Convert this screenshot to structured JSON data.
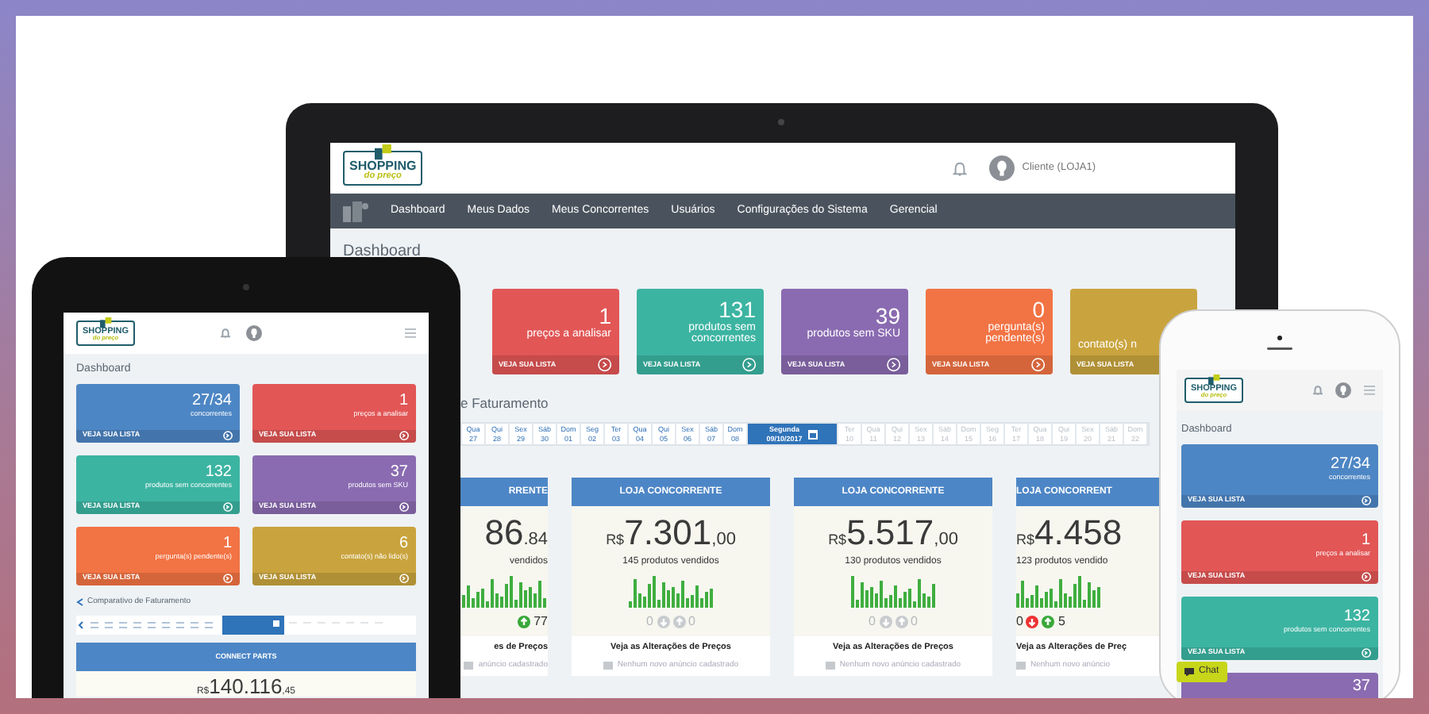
{
  "laptop": {
    "logo": {
      "name": "SHOPPING",
      "tagline": "do preço"
    },
    "user": "Cliente (LOJA1)",
    "nav": [
      "Dashboard",
      "Meus Dados",
      "Meus Concorrentes",
      "Usuários",
      "Configurações do Sistema",
      "Gerencial"
    ],
    "title": "Dashboard",
    "cards": [
      {
        "kind": "full",
        "value": "1",
        "label": "preços a analisar",
        "link": "VEJA SUA LISTA",
        "color": "#e25656"
      },
      {
        "kind": "full",
        "value": "131",
        "label": "produtos sem concorrentes",
        "link": "VEJA SUA LISTA",
        "color": "#3cb4a2"
      },
      {
        "kind": "full",
        "value": "39",
        "label": "produtos sem SKU",
        "link": "VEJA SUA LISTA",
        "color": "#8a6bb1"
      },
      {
        "kind": "full",
        "value": "0",
        "label": "pergunta(s) pendente(s)",
        "link": "VEJA SUA LISTA",
        "color": "#f27344"
      },
      {
        "kind": "cut",
        "label": "contato(s) n",
        "link": "VEJA SUA LISTA",
        "color": "#c9a43e"
      }
    ],
    "chart_title": "e Faturamento",
    "dates": [
      {
        "day": "Qua",
        "date": "27",
        "selected": false,
        "disabled": false
      },
      {
        "day": "Qui",
        "date": "28",
        "selected": false,
        "disabled": false
      },
      {
        "day": "Sex",
        "date": "29",
        "selected": false,
        "disabled": false
      },
      {
        "day": "Sáb",
        "date": "30",
        "selected": false,
        "disabled": false
      },
      {
        "day": "Dom",
        "date": "01",
        "selected": false,
        "disabled": false
      },
      {
        "day": "Seg",
        "date": "02",
        "selected": false,
        "disabled": false
      },
      {
        "day": "Ter",
        "date": "03",
        "selected": false,
        "disabled": false
      },
      {
        "day": "Qua",
        "date": "04",
        "selected": false,
        "disabled": false
      },
      {
        "day": "Qui",
        "date": "05",
        "selected": false,
        "disabled": false
      },
      {
        "day": "Sex",
        "date": "06",
        "selected": false,
        "disabled": false
      },
      {
        "day": "Sáb",
        "date": "07",
        "selected": false,
        "disabled": false
      },
      {
        "day": "Dom",
        "date": "08",
        "selected": false,
        "disabled": false
      },
      {
        "day": "Segunda",
        "date": "09/10/2017",
        "selected": true,
        "disabled": false
      },
      {
        "day": "Ter",
        "date": "10",
        "selected": false,
        "disabled": true
      },
      {
        "day": "Qua",
        "date": "11",
        "selected": false,
        "disabled": true
      },
      {
        "day": "Qui",
        "date": "12",
        "selected": false,
        "disabled": true
      },
      {
        "day": "Sex",
        "date": "13",
        "selected": false,
        "disabled": true
      },
      {
        "day": "Sáb",
        "date": "14",
        "selected": false,
        "disabled": true
      },
      {
        "day": "Dom",
        "date": "15",
        "selected": false,
        "disabled": true
      },
      {
        "day": "Seg",
        "date": "16",
        "selected": false,
        "disabled": true
      },
      {
        "day": "Ter",
        "date": "17",
        "selected": false,
        "disabled": true
      },
      {
        "day": "Qua",
        "date": "18",
        "selected": false,
        "disabled": true
      },
      {
        "day": "Qui",
        "date": "19",
        "selected": false,
        "disabled": true
      },
      {
        "day": "Sex",
        "date": "20",
        "selected": false,
        "disabled": true
      },
      {
        "day": "Sáb",
        "date": "21",
        "selected": false,
        "disabled": true
      },
      {
        "day": "Dom",
        "date": "22",
        "selected": false,
        "disabled": true
      }
    ],
    "stores": [
      {
        "kind": "cut-left",
        "header": "RRENTE",
        "amount": "86",
        "cents": ".84",
        "sold": "vendidos",
        "up": "77",
        "active": true,
        "link": "es de Preços",
        "note": "anúncio cadastrado"
      },
      {
        "kind": "full",
        "header": "LOJA CONCORRENTE",
        "currency": "R$",
        "amount": "7.301",
        "cents": ",00",
        "sold": "145 produtos vendidos",
        "down": "0",
        "up": "0",
        "active": false,
        "link": "Veja as Alterações de Preços",
        "note": "Nenhum novo anúncio cadastrado"
      },
      {
        "kind": "full",
        "header": "LOJA CONCORRENTE",
        "currency": "R$",
        "amount": "5.517",
        "cents": ",00",
        "sold": "130 produtos vendidos",
        "down": "0",
        "up": "0",
        "active": false,
        "link": "Veja as Alterações de Preços",
        "note": "Nenhum novo anúncio cadastrado"
      },
      {
        "kind": "cut-right",
        "header": "LOJA CONCORRENT",
        "currency": "R$",
        "amount": "4.458",
        "sold": "123 produtos vendido",
        "down": "0",
        "up": "5",
        "active": true,
        "link": "Veja as Alterações de Preç",
        "note": "Nenhum novo anúncio"
      }
    ]
  },
  "tablet": {
    "logo": {
      "name": "SHOPPING",
      "tagline": "do preço"
    },
    "title": "Dashboard",
    "cards": [
      {
        "kind": "full",
        "value": "27/34",
        "label": "concorrentes",
        "link": "VEJA SUA LISTA",
        "color": "#4d86c4"
      },
      {
        "kind": "full",
        "value": "1",
        "label": "preços a analisar",
        "link": "VEJA SUA LISTA",
        "color": "#e25656"
      },
      {
        "kind": "full",
        "value": "132",
        "label": "produtos sem concorrentes",
        "link": "VEJA SUA LISTA",
        "color": "#3cb4a2"
      },
      {
        "kind": "full",
        "value": "37",
        "label": "produtos sem SKU",
        "link": "VEJA SUA LISTA",
        "color": "#8a6bb1"
      },
      {
        "kind": "full",
        "value": "1",
        "label": "pergunta(s) pendente(s)",
        "link": "VEJA SUA LISTA",
        "color": "#f27344"
      },
      {
        "kind": "full",
        "value": "6",
        "label": "contato(s) não lido(s)",
        "link": "VEJA SUA LISTA",
        "color": "#c9a43e"
      }
    ],
    "chart_title": "Comparativo de Faturamento",
    "panel": {
      "header": "CONNECT PARTS",
      "currency": "R$",
      "amount": "140.116",
      "cents": ",45"
    }
  },
  "phone": {
    "logo": {
      "name": "SHOPPING",
      "tagline": "do preço"
    },
    "title": "Dashboard",
    "cards": [
      {
        "kind": "full",
        "value": "27/34",
        "label": "concorrentes",
        "link": "VEJA SUA LISTA",
        "color": "#4d86c4"
      },
      {
        "kind": "full",
        "value": "1",
        "label": "preços a analisar",
        "link": "VEJA SUA LISTA",
        "color": "#e25656"
      },
      {
        "kind": "full",
        "value": "132",
        "label": "produtos sem concorrentes",
        "link": "VEJA SUA LISTA",
        "color": "#3cb4a2"
      },
      {
        "kind": "value-only",
        "value": "37",
        "color": "#8a6bb1"
      }
    ],
    "chat": "Chat"
  }
}
